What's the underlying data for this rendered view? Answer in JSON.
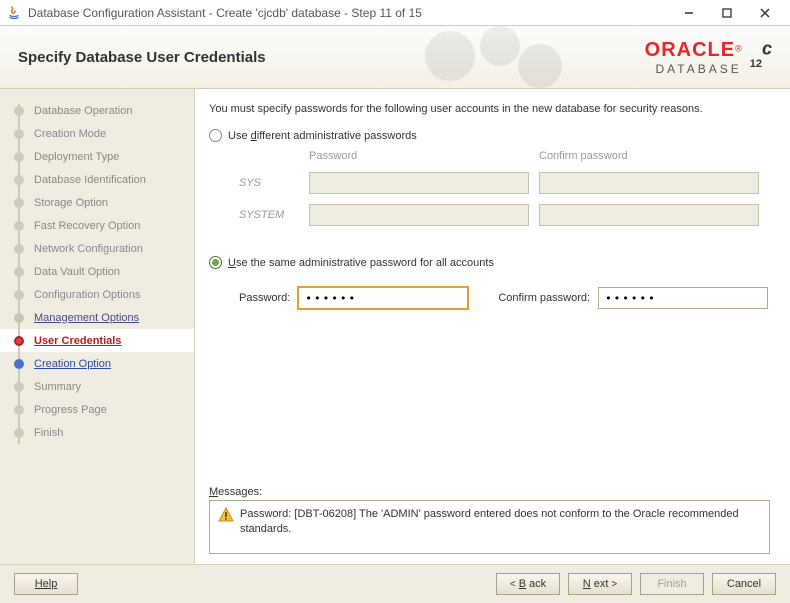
{
  "window": {
    "title": "Database Configuration Assistant - Create 'cjcdb' database - Step 11 of 15"
  },
  "banner": {
    "title": "Specify Database User Credentials",
    "brand": "ORACLE",
    "brand_sub": "DATABASE",
    "version": "12",
    "version_sup": "c"
  },
  "nav": {
    "items": [
      {
        "label": "Database Operation",
        "state": "done"
      },
      {
        "label": "Creation Mode",
        "state": "done"
      },
      {
        "label": "Deployment Type",
        "state": "done"
      },
      {
        "label": "Database Identification",
        "state": "done"
      },
      {
        "label": "Storage Option",
        "state": "done"
      },
      {
        "label": "Fast Recovery Option",
        "state": "done"
      },
      {
        "label": "Network Configuration",
        "state": "done"
      },
      {
        "label": "Data Vault Option",
        "state": "done"
      },
      {
        "label": "Configuration Options",
        "state": "done"
      },
      {
        "label": "Management Options",
        "state": "visited"
      },
      {
        "label": "User Credentials",
        "state": "current"
      },
      {
        "label": "Creation Option",
        "state": "next"
      },
      {
        "label": "Summary",
        "state": "future"
      },
      {
        "label": "Progress Page",
        "state": "future"
      },
      {
        "label": "Finish",
        "state": "future"
      }
    ]
  },
  "main": {
    "instruction": "You must specify passwords for the following user accounts in the new database for security reasons.",
    "radio1_label_pre": "Use ",
    "radio1_label_u": "d",
    "radio1_label_post": "ifferent administrative passwords",
    "grid": {
      "hdr_password": "Password",
      "hdr_confirm": "Confirm password",
      "row_sys": "SYS",
      "row_system": "SYSTEM"
    },
    "radio2_label_u": "U",
    "radio2_label_post": "se the same administrative password for all accounts",
    "same": {
      "password_label": "Password:",
      "password_value": "••••••",
      "confirm_label": "Confirm password:",
      "confirm_value": "••••••"
    },
    "messages_label_u": "M",
    "messages_label_post": "essages:",
    "message_text": "Password: [DBT-06208] The 'ADMIN' password entered does not conform to the Oracle recommended standards."
  },
  "footer": {
    "help": "Help",
    "back": "Back",
    "next": "Next",
    "finish": "Finish",
    "cancel": "Cancel"
  }
}
